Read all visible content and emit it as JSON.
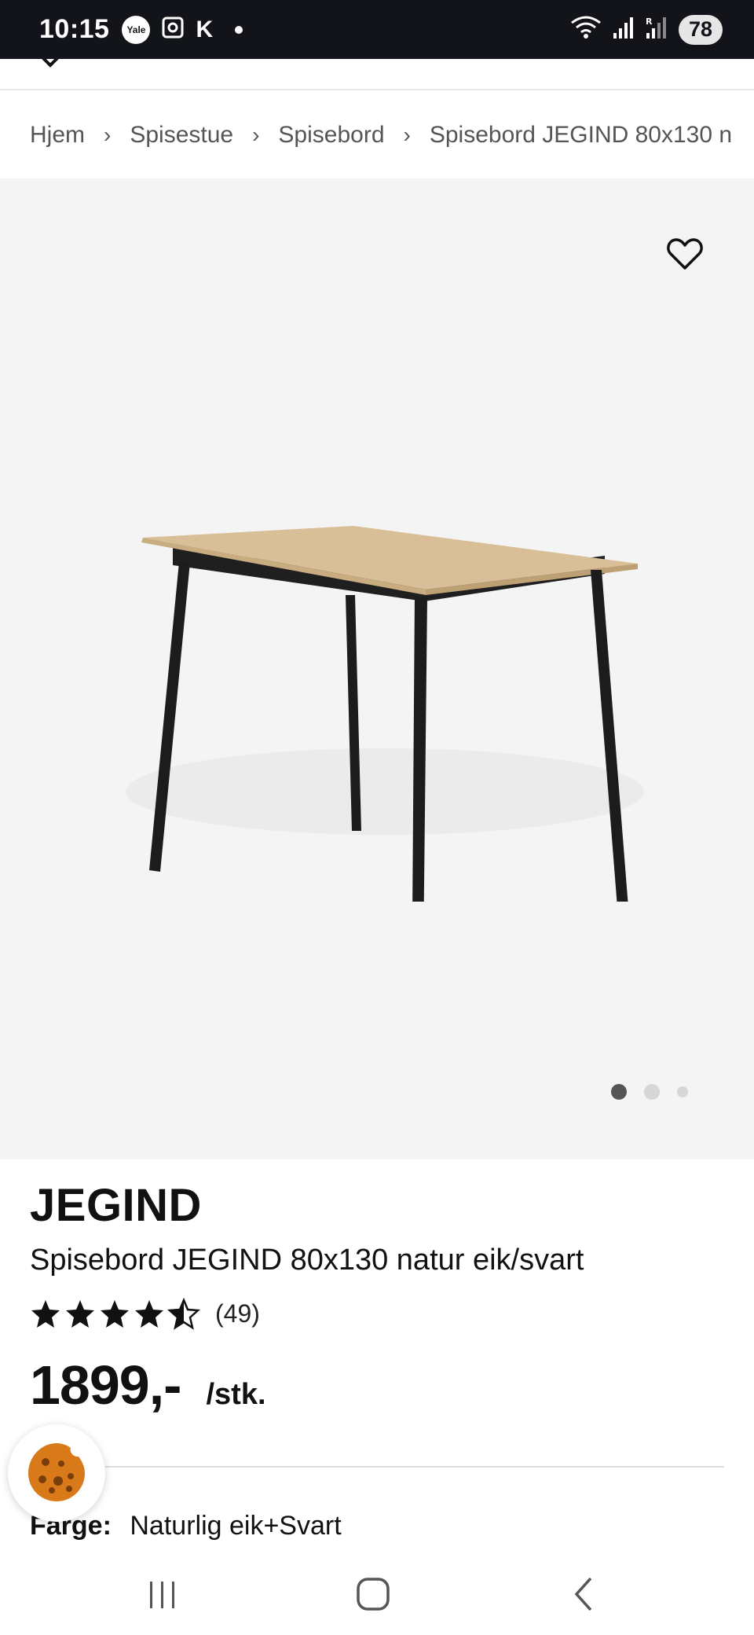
{
  "status_bar": {
    "time": "10:15",
    "yale_label": "Yale",
    "k_label": "K",
    "battery": "78"
  },
  "breadcrumb": {
    "items": [
      "Hjem",
      "Spisestue",
      "Spisebord",
      "Spisebord JEGIND 80x130 n"
    ],
    "separator": "›"
  },
  "gallery": {
    "image_count": 3,
    "active_index": 0
  },
  "product": {
    "brand": "JEGIND",
    "name": "Spisebord JEGIND 80x130 natur eik/svart",
    "rating": 4.5,
    "rating_max": 5,
    "review_count": "(49)",
    "price": "1899,-",
    "unit": "/stk.",
    "color_label": "Farge:",
    "color_value": "Naturlig eik+Svart"
  },
  "colors": {
    "status_bar_bg": "#12141a",
    "gallery_bg": "#f4f4f4",
    "tabletop": "#d8bf97",
    "legs": "#1c1c1c",
    "cookie": "#d97a1a"
  },
  "icons": {
    "favorite": "heart-outline-icon",
    "cookie": "cookie-icon",
    "star": "star-icon",
    "nav_recent": "recent-apps-icon",
    "nav_home": "home-icon",
    "nav_back": "back-icon"
  }
}
